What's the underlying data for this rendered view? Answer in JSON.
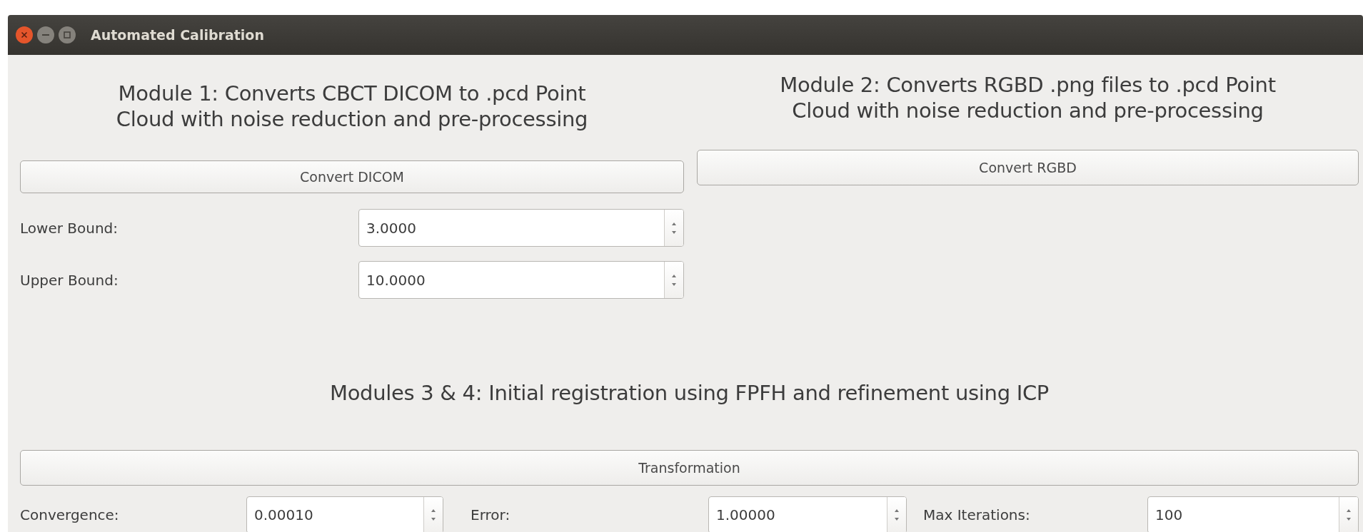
{
  "window": {
    "title": "Automated Calibration"
  },
  "module_1": {
    "heading": "Module 1: Converts CBCT DICOM to .pcd Point\nCloud with noise reduction and pre-processing",
    "button": "Convert DICOM",
    "fields": [
      {
        "label": "Lower Bound:",
        "value": "3.0000"
      },
      {
        "label": "Upper Bound:",
        "value": "10.0000"
      }
    ]
  },
  "module_2": {
    "heading": "Module 2: Converts RGBD .png files to .pcd Point\nCloud with noise reduction and pre-processing",
    "button": "Convert RGBD"
  },
  "modules_3_4": {
    "heading": "Modules 3 & 4: Initial registration using FPFH and refinement using ICP",
    "button": "Transformation",
    "fields": [
      {
        "label": "Convergence:",
        "value": "0.00010"
      },
      {
        "label": "Error:",
        "value": "1.00000"
      },
      {
        "label": "Max Iterations:",
        "value": "100"
      }
    ]
  }
}
